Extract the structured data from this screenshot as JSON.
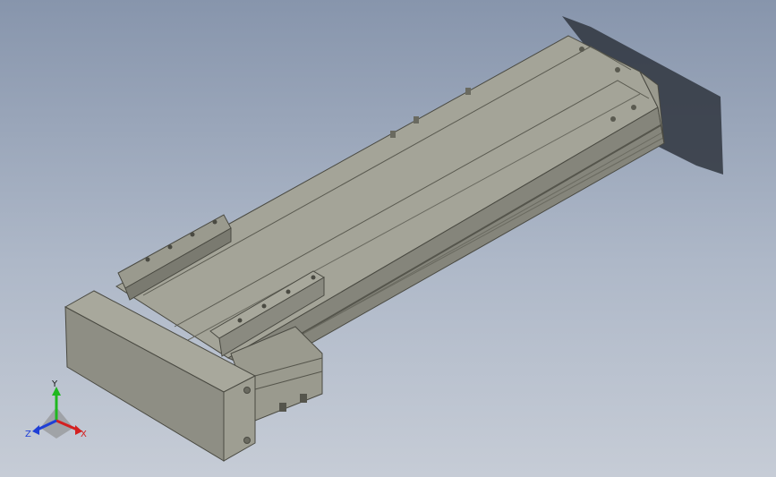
{
  "viewport": {
    "background_top": "#8795ac",
    "background_bottom": "#c6ccd6"
  },
  "model": {
    "body_color": "#9a9a8e",
    "top_color": "#a7a79b",
    "side_color": "#84847a",
    "dark_color": "#55554c",
    "shadow_color": "#3a3f48"
  },
  "triad": {
    "x_label": "X",
    "y_label": "Y",
    "z_label": "Z",
    "x_color": "#d42020",
    "y_color": "#1fb81f",
    "z_color": "#1f3fd6"
  }
}
